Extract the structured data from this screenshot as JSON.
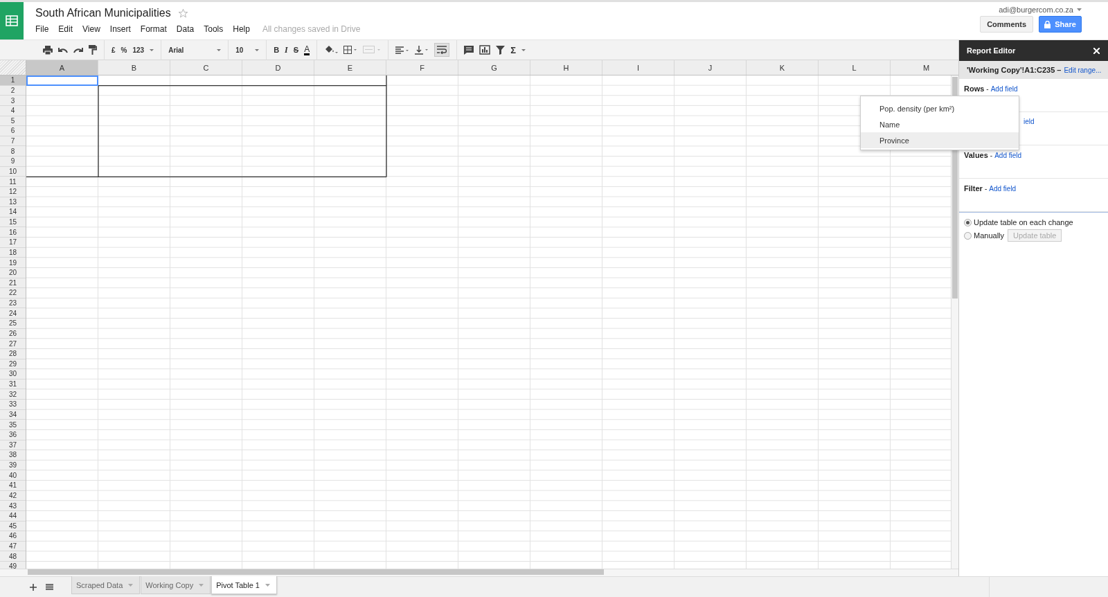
{
  "app": {
    "title": "South African Municipalities",
    "starred": false,
    "menu": [
      "File",
      "Edit",
      "View",
      "Insert",
      "Format",
      "Data",
      "Tools",
      "Help"
    ],
    "save_status": "All changes saved in Drive",
    "account": "adi@burgercom.co.za",
    "comments_button": "Comments",
    "share_button": "Share"
  },
  "toolbar": {
    "currency": "£",
    "percent": "%",
    "number_format": "123",
    "font": "Arial",
    "font_size": "10",
    "bold": "B",
    "italic": "I",
    "strike": "S",
    "text_color": "A",
    "functions": "Σ",
    "text_wrap": true
  },
  "sheet": {
    "columns": [
      {
        "label": "A",
        "selected": true
      },
      {
        "label": "B",
        "selected": false
      },
      {
        "label": "C",
        "selected": false
      },
      {
        "label": "D",
        "selected": false
      },
      {
        "label": "E",
        "selected": false
      },
      {
        "label": "F",
        "selected": false
      },
      {
        "label": "G",
        "selected": false
      },
      {
        "label": "H",
        "selected": false
      },
      {
        "label": "I",
        "selected": false
      },
      {
        "label": "J",
        "selected": false
      },
      {
        "label": "K",
        "selected": false
      },
      {
        "label": "L",
        "selected": false
      },
      {
        "label": "M",
        "selected": false
      }
    ],
    "rows": [
      {
        "label": "1",
        "selected": true
      },
      {
        "label": "2",
        "selected": false
      },
      {
        "label": "3",
        "selected": false
      },
      {
        "label": "4",
        "selected": false
      },
      {
        "label": "5",
        "selected": false
      },
      {
        "label": "6",
        "selected": false
      },
      {
        "label": "7",
        "selected": false
      },
      {
        "label": "8",
        "selected": false
      },
      {
        "label": "9",
        "selected": false
      },
      {
        "label": "10",
        "selected": false
      },
      {
        "label": "11",
        "selected": false
      },
      {
        "label": "12",
        "selected": false
      },
      {
        "label": "13",
        "selected": false
      },
      {
        "label": "14",
        "selected": false
      },
      {
        "label": "15",
        "selected": false
      },
      {
        "label": "16",
        "selected": false
      },
      {
        "label": "17",
        "selected": false
      },
      {
        "label": "18",
        "selected": false
      },
      {
        "label": "19",
        "selected": false
      },
      {
        "label": "20",
        "selected": false
      },
      {
        "label": "21",
        "selected": false
      },
      {
        "label": "22",
        "selected": false
      },
      {
        "label": "23",
        "selected": false
      },
      {
        "label": "24",
        "selected": false
      },
      {
        "label": "25",
        "selected": false
      },
      {
        "label": "26",
        "selected": false
      },
      {
        "label": "27",
        "selected": false
      },
      {
        "label": "28",
        "selected": false
      },
      {
        "label": "29",
        "selected": false
      },
      {
        "label": "30",
        "selected": false
      },
      {
        "label": "31",
        "selected": false
      },
      {
        "label": "32",
        "selected": false
      },
      {
        "label": "33",
        "selected": false
      },
      {
        "label": "34",
        "selected": false
      },
      {
        "label": "35",
        "selected": false
      },
      {
        "label": "36",
        "selected": false
      },
      {
        "label": "37",
        "selected": false
      },
      {
        "label": "38",
        "selected": false
      },
      {
        "label": "39",
        "selected": false
      },
      {
        "label": "40",
        "selected": false
      },
      {
        "label": "41",
        "selected": false
      },
      {
        "label": "42",
        "selected": false
      },
      {
        "label": "43",
        "selected": false
      },
      {
        "label": "44",
        "selected": false
      },
      {
        "label": "45",
        "selected": false
      },
      {
        "label": "46",
        "selected": false
      },
      {
        "label": "47",
        "selected": false
      },
      {
        "label": "48",
        "selected": false
      },
      {
        "label": "49",
        "selected": false
      }
    ]
  },
  "dropdown": {
    "items": [
      {
        "label": "Pop. density (per km²)",
        "selected": false
      },
      {
        "label": "Name",
        "selected": false
      },
      {
        "label": "Province",
        "selected": true
      }
    ]
  },
  "report_editor": {
    "title": "Report Editor",
    "range": "'Working Copy'!A1:C235 –",
    "edit_link": "Edit range...",
    "sections": [
      {
        "label": "Rows",
        "separator": "-",
        "link": "Add field"
      },
      {
        "link": "ield"
      },
      {
        "label": "Values",
        "separator": "-",
        "link": "Add field"
      },
      {
        "label": "Filter",
        "separator": "-",
        "link": "Add field"
      }
    ],
    "update_options": [
      {
        "label": "Update table on each change",
        "selected": true
      },
      {
        "label": "Manually",
        "selected": false
      }
    ],
    "update_button": "Update table"
  },
  "sheet_tabs": [
    {
      "label": "Scraped Data",
      "selected": false
    },
    {
      "label": "Working Copy",
      "selected": false
    },
    {
      "label": "Pivot Table 1",
      "selected": true
    }
  ]
}
